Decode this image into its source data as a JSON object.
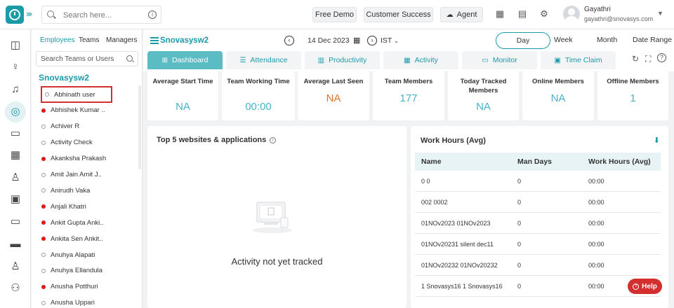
{
  "search": {
    "placeholder": "Search here..."
  },
  "topbar": {
    "free_demo": "Free Demo",
    "customer_success": "Customer Success",
    "agent": "Agent",
    "user_name": "Gayathri",
    "user_email": "gayathri@snovasys.com"
  },
  "emp_panel": {
    "tabs": [
      "Employees",
      "Teams",
      "Managers"
    ],
    "search_placeholder": "Search Teams or Users",
    "org_name": "Snovasysw2",
    "employees": [
      {
        "name": "Abhinath user",
        "status": "offline"
      },
      {
        "name": "Abhishek Kumar ..",
        "status": "online"
      },
      {
        "name": "Achiver R",
        "status": "offline"
      },
      {
        "name": "Activity Check",
        "status": "offline"
      },
      {
        "name": "Akanksha Prakash",
        "status": "online"
      },
      {
        "name": "Amit Jain Amit J..",
        "status": "offline"
      },
      {
        "name": "Anirudh Vaka",
        "status": "offline"
      },
      {
        "name": "Anjali Khatri",
        "status": "online"
      },
      {
        "name": "Ankit Gupta Anki..",
        "status": "online"
      },
      {
        "name": "Ankita Sen Ankit..",
        "status": "online"
      },
      {
        "name": "Anuhya Alapati",
        "status": "offline"
      },
      {
        "name": "Anuhya Ellandula",
        "status": "offline"
      },
      {
        "name": "Anusha Potthuri",
        "status": "online"
      },
      {
        "name": "Anusha Uppari",
        "status": "offline"
      }
    ]
  },
  "header": {
    "title": "Snovasysw2",
    "date": "14 Dec 2023",
    "timezone": "IST",
    "periods": [
      "Day",
      "Week",
      "Month",
      "Date Range"
    ],
    "tabs": [
      "Dashboard",
      "Attendance",
      "Productivity",
      "Activity",
      "Monitor",
      "Time Claim"
    ]
  },
  "stats": [
    {
      "label": "Average Start Time",
      "value": "NA"
    },
    {
      "label": "Team Working Time",
      "value": "00:00"
    },
    {
      "label": "Average Last Seen",
      "value": "NA"
    },
    {
      "label": "Team Members",
      "value": "177"
    },
    {
      "label": "Today Tracked Members",
      "value": "NA"
    },
    {
      "label": "Online Members",
      "value": "NA"
    },
    {
      "label": "Offline Members",
      "value": "1"
    }
  ],
  "top_apps": {
    "title": "Top 5 websites & applications",
    "empty_text": "Activity not yet tracked"
  },
  "work_hours": {
    "title": "Work Hours (Avg)",
    "columns": [
      "Name",
      "Man Days",
      "Work Hours (Avg)"
    ],
    "rows": [
      [
        "0 0",
        "0",
        "00:00"
      ],
      [
        "002 0002",
        "0",
        "00:00"
      ],
      [
        "01NOv2023 01NOv2023",
        "0",
        "00:00"
      ],
      [
        "01NOv20231 silent dec11",
        "0",
        "00:00"
      ],
      [
        "01NOv20232 01NOv20232",
        "0",
        "00:00"
      ],
      [
        "1 Snovasys16 1 Snovasys16",
        "0",
        "00:00"
      ]
    ]
  },
  "help": {
    "label": "Help"
  },
  "colors": {
    "accent": "#1b9aa8",
    "active_tab": "#5bbcc4",
    "online_dot": "#d91b1b",
    "help": "#d32f2f"
  }
}
